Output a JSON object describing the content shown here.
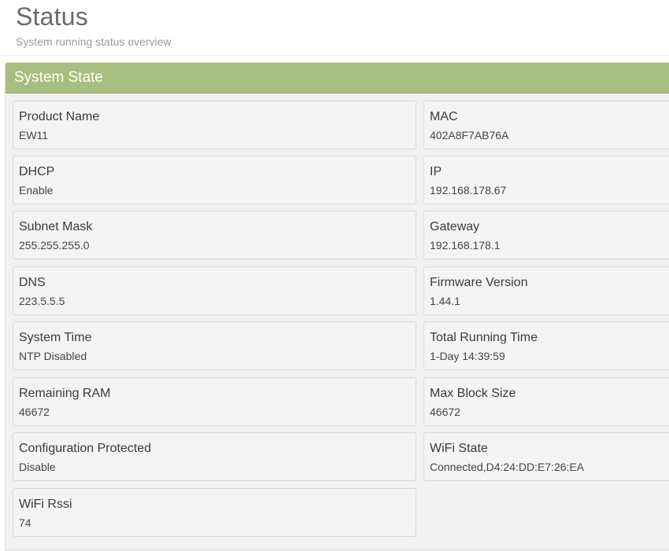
{
  "header": {
    "title": "Status",
    "subtitle": "System running status overview"
  },
  "panel": {
    "title": "System State",
    "items": [
      {
        "label": "Product Name",
        "value": "EW11"
      },
      {
        "label": "MAC",
        "value": "402A8F7AB76A"
      },
      {
        "label": "DHCP",
        "value": "Enable"
      },
      {
        "label": "IP",
        "value": "192.168.178.67"
      },
      {
        "label": "Subnet Mask",
        "value": "255.255.255.0"
      },
      {
        "label": "Gateway",
        "value": "192.168.178.1"
      },
      {
        "label": "DNS",
        "value": "223.5.5.5"
      },
      {
        "label": "Firmware Version",
        "value": "1.44.1"
      },
      {
        "label": "System Time",
        "value": "NTP Disabled"
      },
      {
        "label": "Total Running Time",
        "value": "1-Day 14:39:59"
      },
      {
        "label": "Remaining RAM",
        "value": "46672"
      },
      {
        "label": "Max Block Size",
        "value": "46672"
      },
      {
        "label": "Configuration Protected",
        "value": "Disable"
      },
      {
        "label": "WiFi State",
        "value": "Connected,D4:24:DD:E7:26:EA"
      },
      {
        "label": "WiFi Rssi",
        "value": "74"
      }
    ]
  },
  "colors": {
    "panel_heading": "#a6bf7e",
    "card_bg": "#f4f4f4"
  }
}
